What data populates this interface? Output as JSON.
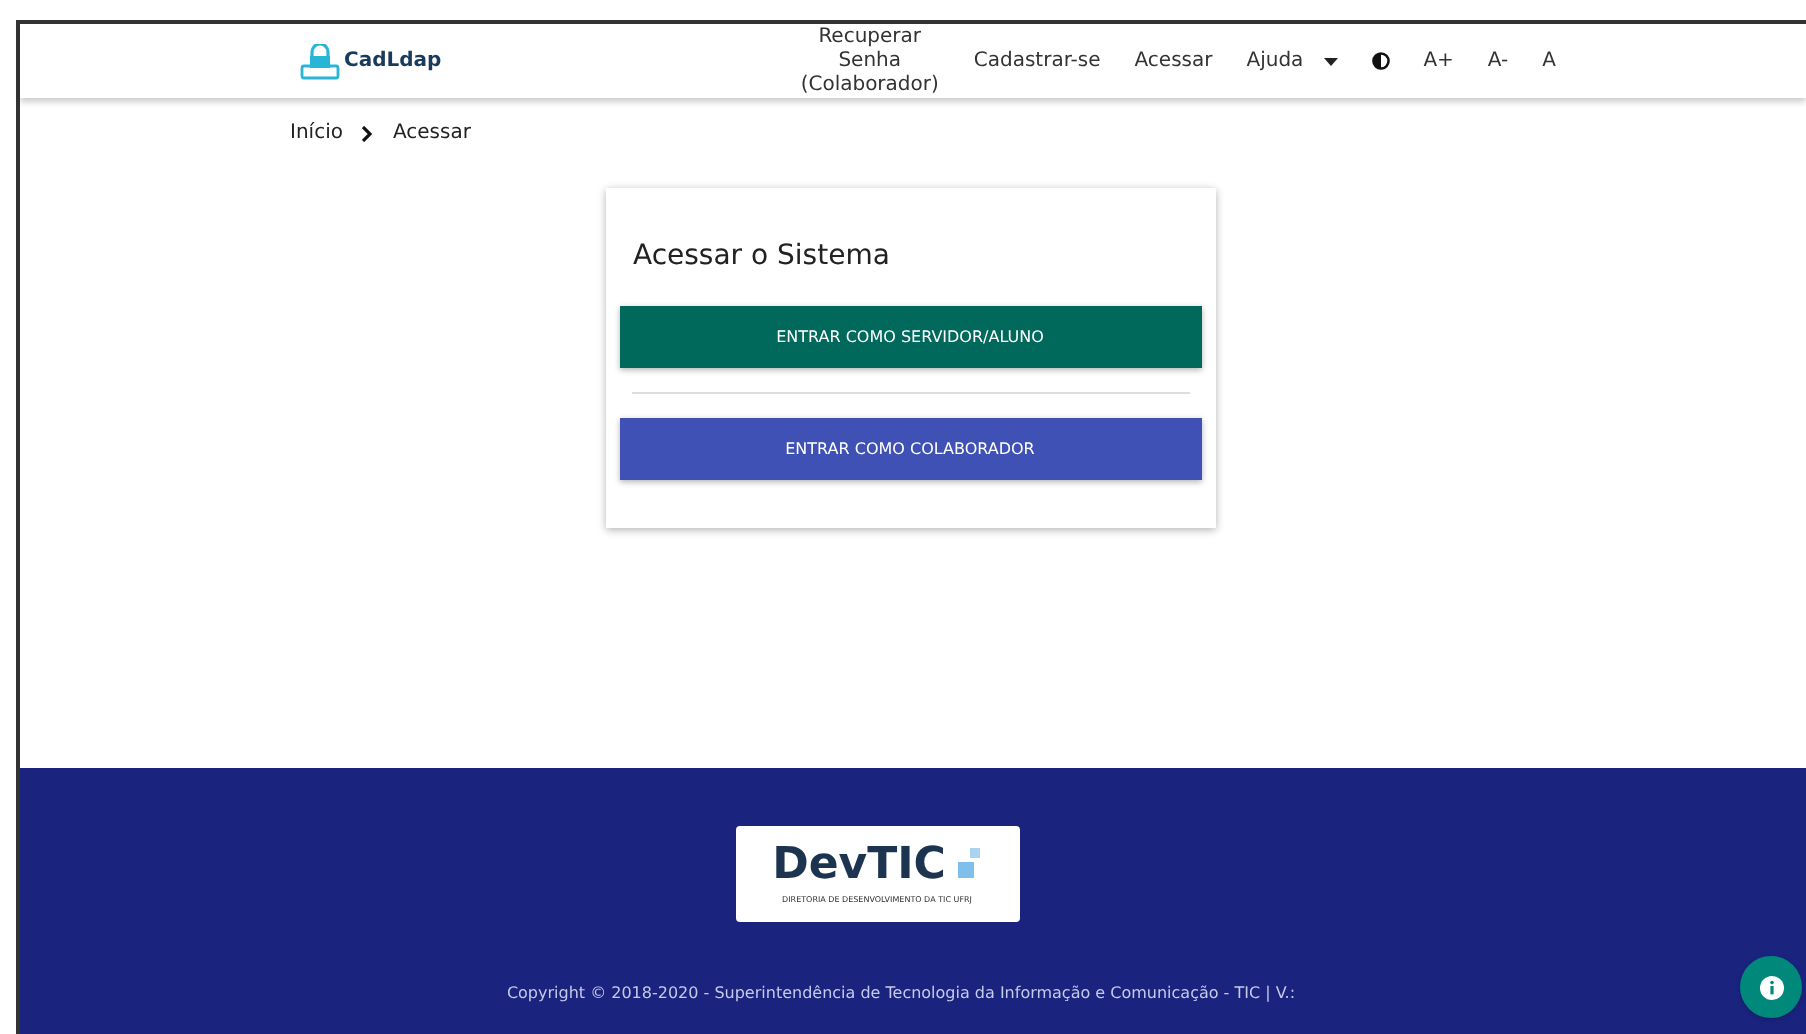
{
  "header": {
    "brand": "CadLdap",
    "nav": [
      {
        "kind": "link",
        "label": "Recuperar Senha (Colaborador)"
      },
      {
        "kind": "link",
        "label": "Cadastrar-se"
      },
      {
        "kind": "link",
        "label": "Acessar"
      },
      {
        "kind": "dropdown",
        "label": "Ajuda"
      },
      {
        "kind": "contrast"
      },
      {
        "kind": "text",
        "label": "A+"
      },
      {
        "kind": "text",
        "label": "A-"
      },
      {
        "kind": "text",
        "label": "A"
      }
    ]
  },
  "breadcrumb": [
    {
      "label": "Início"
    },
    {
      "label": "Acessar"
    }
  ],
  "card": {
    "title": "Acessar o Sistema",
    "buttons": [
      {
        "label": "ENTRAR COMO SERVIDOR/ALUNO",
        "color": "#00695c"
      },
      {
        "label": "ENTRAR COMO COLABORADOR",
        "color": "#3f51b5"
      }
    ]
  },
  "footer": {
    "logo": {
      "title": "DevTIC",
      "subtitle": "DIRETORIA DE DESENVOLVIMENTO DA TIC UFRJ"
    },
    "copyright": "Copyright © 2018-2020 - Superintendência de Tecnologia da Informação e Comunicação - TIC | V.:"
  }
}
